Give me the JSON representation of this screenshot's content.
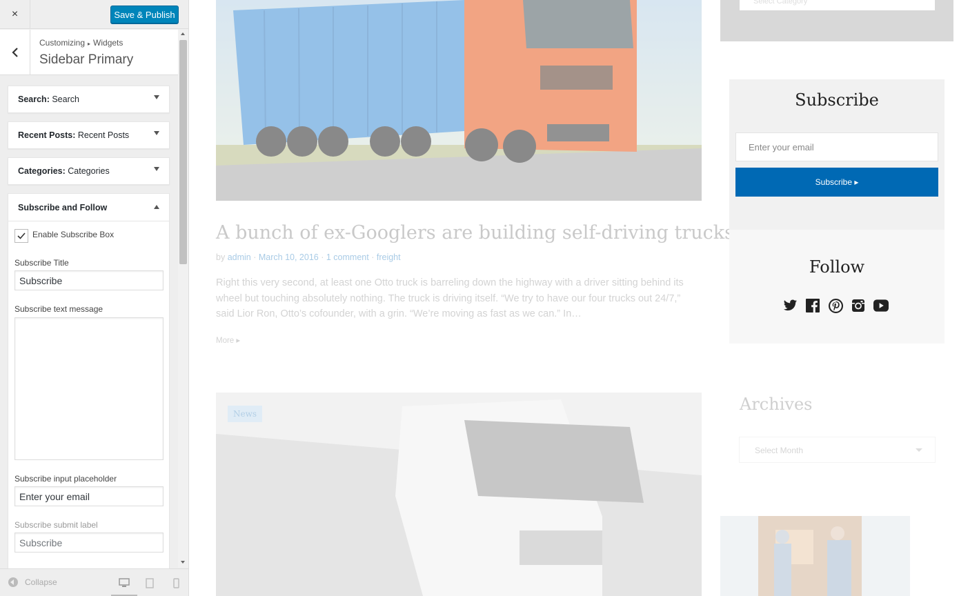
{
  "header": {
    "close_label": "×",
    "publish_label": "Save & Publish"
  },
  "section": {
    "breadcrumb_root": "Customizing",
    "breadcrumb_sep": "▸",
    "breadcrumb_current": "Widgets",
    "title": "Sidebar Primary"
  },
  "widgets": [
    {
      "name": "Search:",
      "instance": "Search"
    },
    {
      "name": "Recent Posts:",
      "instance": "Recent Posts"
    },
    {
      "name": "Categories:",
      "instance": "Categories"
    }
  ],
  "subscribe_widget": {
    "title": "Subscribe and Follow",
    "enable_label": "Enable Subscribe Box",
    "enable_checked": true,
    "title_label": "Subscribe Title",
    "title_value": "Subscribe",
    "text_label": "Subscribe text message",
    "text_value": "",
    "placeholder_label": "Subscribe input placeholder",
    "placeholder_value": "Enter your email",
    "submit_label": "Subscribe submit label",
    "submit_placeholder": "Subscribe"
  },
  "footer": {
    "collapse_label": "Collapse"
  },
  "preview": {
    "post": {
      "title": "A bunch of ex-Googlers are building self-driving trucks",
      "by": "by",
      "author": "admin",
      "date": "March 10, 2016",
      "comments": "1 comment",
      "category": "freight",
      "excerpt": "Right this very second, at least one Otto truck is barreling down the highway with a driver sitting behind its wheel but touching absolutely nothing. The truck is driving itself. “We try to have our four trucks out 24/7,” said Lior Ron, Otto’s cofounder, with a grin. “We’re moving as fast as we can.” In…",
      "more": "More ▸"
    },
    "news_badge": "News",
    "sidebar": {
      "category_select": "Select Category",
      "subscribe_title": "Subscribe",
      "subscribe_placeholder": "Enter your email",
      "subscribe_button": "Subscribe ▸",
      "follow_title": "Follow",
      "social": [
        "twitter-icon",
        "facebook-icon",
        "pinterest-icon",
        "instagram-icon",
        "youtube-icon"
      ],
      "archives_title": "Archives",
      "archives_select": "Select Month"
    },
    "colors": {
      "publish": "#0085ba",
      "subscribe_button": "#0069b4"
    }
  }
}
